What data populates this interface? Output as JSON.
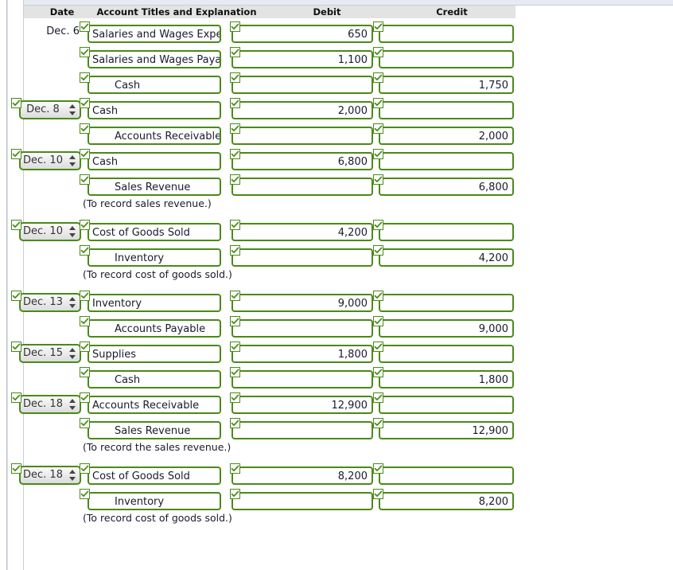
{
  "header": {
    "date": "Date",
    "account": "Account Titles and Explanation",
    "debit": "Debit",
    "credit": "Credit"
  },
  "colors": {
    "field_border": "#4a8a18",
    "header_bg": "#e3e3e3",
    "select_bg": "#dcdcdc",
    "text": "#1a1a2e"
  },
  "icons": {
    "check": "check-icon",
    "spinner": "spinner-arrows-icon"
  },
  "rows": [
    {
      "kind": "entry",
      "date_type": "text",
      "date": "Dec. 6",
      "account": "Salaries and Wages Expen",
      "indent": 0,
      "debit": "650",
      "credit": ""
    },
    {
      "kind": "entry",
      "date_type": "none",
      "date": "",
      "account": "Salaries and Wages Payab",
      "indent": 0,
      "debit": "1,100",
      "credit": ""
    },
    {
      "kind": "entry",
      "date_type": "none",
      "date": "",
      "account": "Cash",
      "indent": 1,
      "debit": "",
      "credit": "1,750"
    },
    {
      "kind": "entry",
      "date_type": "select",
      "date": "Dec. 8",
      "account": "Cash",
      "indent": 0,
      "debit": "2,000",
      "credit": ""
    },
    {
      "kind": "entry",
      "date_type": "none",
      "date": "",
      "account": "Accounts Receivable",
      "indent": 1,
      "debit": "",
      "credit": "2,000"
    },
    {
      "kind": "entry",
      "date_type": "select",
      "date": "Dec. 10",
      "account": "Cash",
      "indent": 0,
      "debit": "6,800",
      "credit": ""
    },
    {
      "kind": "entry",
      "date_type": "none",
      "date": "",
      "account": "Sales Revenue",
      "indent": 1,
      "debit": "",
      "credit": "6,800"
    },
    {
      "kind": "explanation",
      "text": "(To record sales revenue.)"
    },
    {
      "kind": "entry",
      "date_type": "select",
      "date": "Dec. 10",
      "account": "Cost of Goods Sold",
      "indent": 0,
      "debit": "4,200",
      "credit": ""
    },
    {
      "kind": "entry",
      "date_type": "none",
      "date": "",
      "account": "Inventory",
      "indent": 1,
      "debit": "",
      "credit": "4,200"
    },
    {
      "kind": "explanation",
      "text": "(To record cost of goods sold.)"
    },
    {
      "kind": "entry",
      "date_type": "select",
      "date": "Dec. 13",
      "account": "Inventory",
      "indent": 0,
      "debit": "9,000",
      "credit": ""
    },
    {
      "kind": "entry",
      "date_type": "none",
      "date": "",
      "account": "Accounts Payable",
      "indent": 1,
      "debit": "",
      "credit": "9,000"
    },
    {
      "kind": "entry",
      "date_type": "select",
      "date": "Dec. 15",
      "account": "Supplies",
      "indent": 0,
      "debit": "1,800",
      "credit": ""
    },
    {
      "kind": "entry",
      "date_type": "none",
      "date": "",
      "account": "Cash",
      "indent": 1,
      "debit": "",
      "credit": "1,800"
    },
    {
      "kind": "entry",
      "date_type": "select",
      "date": "Dec. 18",
      "account": "Accounts Receivable",
      "indent": 0,
      "debit": "12,900",
      "credit": ""
    },
    {
      "kind": "entry",
      "date_type": "none",
      "date": "",
      "account": "Sales Revenue",
      "indent": 1,
      "debit": "",
      "credit": "12,900"
    },
    {
      "kind": "explanation",
      "text": "(To record the sales revenue.)"
    },
    {
      "kind": "entry",
      "date_type": "select",
      "date": "Dec. 18",
      "account": "Cost of Goods Sold",
      "indent": 0,
      "debit": "8,200",
      "credit": ""
    },
    {
      "kind": "entry",
      "date_type": "none",
      "date": "",
      "account": "Inventory",
      "indent": 1,
      "debit": "",
      "credit": "8,200"
    },
    {
      "kind": "explanation",
      "text": "(To record cost of goods sold.)"
    }
  ]
}
